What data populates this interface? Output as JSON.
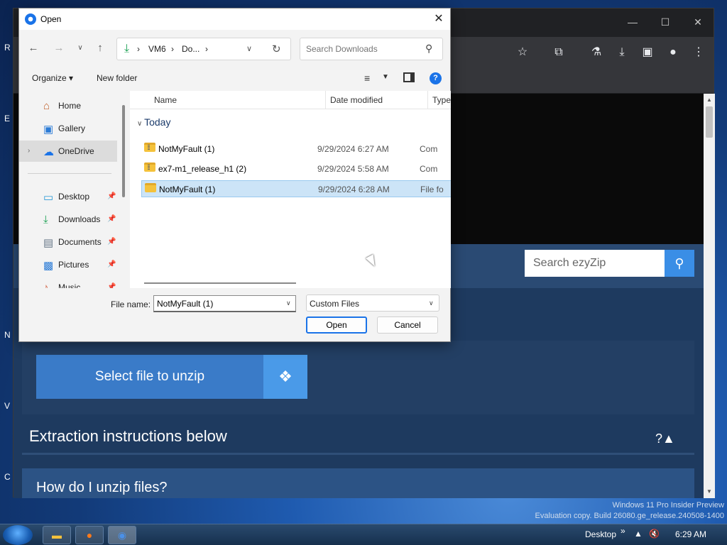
{
  "desktop": {
    "side_letters": [
      "R",
      "E",
      "N",
      "V",
      "C"
    ]
  },
  "browser": {
    "controls": {
      "minimize": "—",
      "maximize": "☐",
      "close": "✕"
    },
    "toolbar_icons": [
      "star-icon",
      "extension-icon",
      "labs-icon",
      "download-icon",
      "sidepanel-icon",
      "profile-icon",
      "menu-icon"
    ]
  },
  "site": {
    "search_placeholder": "Search ezyZip",
    "select_file_label": "Select file to unzip",
    "extraction_heading": "Extraction instructions below",
    "extraction_toggle": "?▲",
    "how_heading": "How do I unzip files?"
  },
  "dialog": {
    "title": "Open",
    "address": {
      "segments": [
        "VM6",
        "Do..."
      ]
    },
    "search_placeholder": "Search Downloads",
    "organize_label": "Organize ▾",
    "new_folder_label": "New folder",
    "nav_items": [
      {
        "label": "Home",
        "icon": "home-icon",
        "pinned": false
      },
      {
        "label": "Gallery",
        "icon": "gallery-icon",
        "pinned": false
      },
      {
        "label": "OneDrive",
        "icon": "cloud-icon",
        "pinned": false,
        "selected": true
      },
      {
        "label": "Desktop",
        "icon": "desktop-icon",
        "pinned": true
      },
      {
        "label": "Downloads",
        "icon": "download-icon",
        "pinned": true
      },
      {
        "label": "Documents",
        "icon": "document-icon",
        "pinned": true
      },
      {
        "label": "Pictures",
        "icon": "picture-icon",
        "pinned": true
      },
      {
        "label": "Music",
        "icon": "music-icon",
        "pinned": true
      }
    ],
    "columns": {
      "name": "Name",
      "date": "Date modified",
      "type": "Type"
    },
    "group_label": "Today",
    "files": [
      {
        "name": "NotMyFault (1)",
        "date": "9/29/2024 6:27 AM",
        "type": "Com",
        "selected": false
      },
      {
        "name": "ex7-m1_release_h1 (2)",
        "date": "9/29/2024 5:58 AM",
        "type": "Com",
        "selected": false
      },
      {
        "name": "NotMyFault (1)",
        "date": "9/29/2024 6:28 AM",
        "type": "File fo",
        "selected": true
      }
    ],
    "filename_label": "File name:",
    "filename_value": "NotMyFault (1)",
    "filetype_value": "Custom Files",
    "open_label": "Open",
    "cancel_label": "Cancel"
  },
  "taskbar": {
    "desktop_label": "Desktop",
    "clock": "6:29 AM",
    "overflow": "»",
    "watermark_line1": "Windows 11 Pro Insider Preview",
    "watermark_line2": "Evaluation copy. Build 26080.ge_release.240508-1400"
  },
  "colors": {
    "accent": "#1a73e8",
    "site_button": "#3a7bc8",
    "site_bg": "#1e3a5f",
    "selection": "#cce4f7"
  }
}
